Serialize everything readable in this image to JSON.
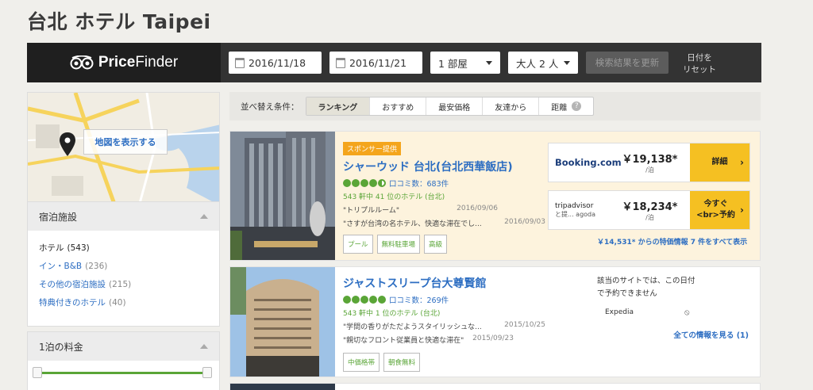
{
  "page_title": "台北 ホテル Taipei",
  "brand": {
    "name_bold": "Price",
    "name_rest": "Finder"
  },
  "search": {
    "checkin": "2016/11/18",
    "checkout": "2016/11/21",
    "rooms": "1 部屋",
    "guests": "大人 2 人",
    "update_label": "検索結果を更新",
    "reset_line1": "日付を",
    "reset_line2": "リセット"
  },
  "map": {
    "show_label": "地図を表示する"
  },
  "lodging": {
    "title": "宿泊施設",
    "items": [
      {
        "label": "ホテル",
        "count": "(543)"
      },
      {
        "label": "イン・B&B",
        "count": "(236)"
      },
      {
        "label": "その他の宿泊施設",
        "count": "(215)"
      },
      {
        "label": "特典付きのホテル",
        "count": "(40)"
      }
    ]
  },
  "price_filter": {
    "title": "1泊の料金"
  },
  "sort": {
    "label": "並べ替え条件：",
    "tabs": [
      "ランキング",
      "おすすめ",
      "最安価格",
      "友達から",
      "距離"
    ],
    "help": "?"
  },
  "results": [
    {
      "sponsor_tag": "スポンサー提供",
      "name": "シャーウッド 台北(台北西華飯店)",
      "reviews": "口コミ数：683件",
      "rank": "543 軒中 41 位のホテル (台北)",
      "review1": {
        "text": "\"トリプルルーム\"",
        "date": "2016/09/06"
      },
      "review2": {
        "text": "\"さすが台湾の名ホテル、快適な滞在でし...",
        "date": "2016/09/03"
      },
      "tags": [
        "プール",
        "無料駐車場",
        "高級"
      ],
      "deals": [
        {
          "provider": "Booking.com",
          "price": "￥19,138*",
          "unit": "/泊",
          "button": "詳細",
          "arrow": "›"
        },
        {
          "provider": "tripadvisor",
          "provider_sub": "と提... agoda",
          "price": "￥18,234*",
          "unit": "/泊",
          "button_line1": "今すぐ",
          "button_line2": "<br>予約",
          "arrow": "›"
        }
      ],
      "more_deals": "￥14,531* からの特価情報 7 件をすべて表示"
    },
    {
      "name": "ジャストスリープ台大尊賢館",
      "reviews": "口コミ数：269件",
      "rank": "543 軒中 1 位のホテル (台北)",
      "review1": {
        "text": "\"学問の香りがただようスタイリッシュな...",
        "date": "2015/10/25"
      },
      "review2": {
        "text": "\"親切なフロント従業員と快適な滞在\"",
        "date": "2015/09/23"
      },
      "tags": [
        "中価格帯",
        "朝食無料"
      ],
      "unavailable_line1": "該当のサイトでは、この日付",
      "unavailable_line2": "で予約できません",
      "provider": "Expedia",
      "not_available_icon": "⦸",
      "all_info": "全ての情報を見る (1)"
    }
  ],
  "colors": {
    "link": "#2d6ec2",
    "green": "#5aa537",
    "cta": "#f5c022",
    "sponsor": "#f4a51c"
  }
}
